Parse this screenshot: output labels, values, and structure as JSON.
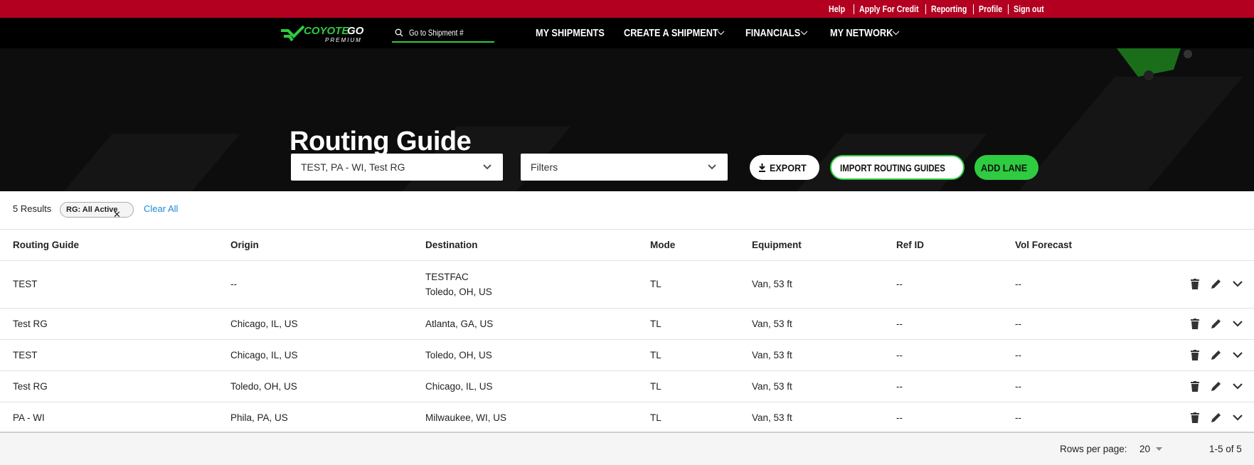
{
  "topbar": {
    "links": [
      "Help",
      "Apply For Credit",
      "Reporting",
      "Profile",
      "Sign out"
    ]
  },
  "nav": {
    "logo": "COYOTEGO PREMIUM",
    "search_placeholder": "Go to Shipment #",
    "items": [
      {
        "label": "MY SHIPMENTS",
        "dropdown": false
      },
      {
        "label": "CREATE A SHIPMENT",
        "dropdown": true
      },
      {
        "label": "FINANCIALS",
        "dropdown": true
      },
      {
        "label": "MY NETWORK",
        "dropdown": true
      }
    ]
  },
  "hero": {
    "title": "Routing Guide",
    "rg_select": "TEST, PA - WI, Test RG",
    "filters_select": "Filters",
    "export": "EXPORT",
    "import": "IMPORT ROUTING GUIDES",
    "add_lane": "ADD LANE"
  },
  "colors": {
    "topbar": "#b30021",
    "accent_green": "#2ecc40",
    "link": "#1a8ad4"
  },
  "results": {
    "count": "5 Results",
    "chip": "RG: All Active",
    "clear": "Clear All"
  },
  "table": {
    "columns": [
      "Routing Guide",
      "Origin",
      "Destination",
      "Mode",
      "Equipment",
      "Ref ID",
      "Vol Forecast"
    ],
    "rows": [
      {
        "rg": "TEST",
        "origin": "--",
        "dest1": "TESTFAC",
        "dest2": "Toledo, OH, US",
        "mode": "TL",
        "equipment": "Van, 53 ft",
        "ref": "--",
        "vol": "--"
      },
      {
        "rg": "Test RG",
        "origin": "Chicago, IL, US",
        "dest1": "",
        "dest2": "Atlanta, GA, US",
        "mode": "TL",
        "equipment": "Van, 53 ft",
        "ref": "--",
        "vol": "--"
      },
      {
        "rg": "TEST",
        "origin": "Chicago, IL, US",
        "dest1": "",
        "dest2": "Toledo, OH, US",
        "mode": "TL",
        "equipment": "Van, 53 ft",
        "ref": "--",
        "vol": "--"
      },
      {
        "rg": "Test RG",
        "origin": "Toledo, OH, US",
        "dest1": "",
        "dest2": "Chicago, IL, US",
        "mode": "TL",
        "equipment": "Van, 53 ft",
        "ref": "--",
        "vol": "--"
      },
      {
        "rg": "PA - WI",
        "origin": "Phila, PA, US",
        "dest1": "",
        "dest2": "Milwaukee, WI, US",
        "mode": "TL",
        "equipment": "Van, 53 ft",
        "ref": "--",
        "vol": "--"
      }
    ]
  },
  "footer": {
    "rows_label": "Rows per page:",
    "rows_value": "20",
    "range": "1-5 of 5"
  }
}
